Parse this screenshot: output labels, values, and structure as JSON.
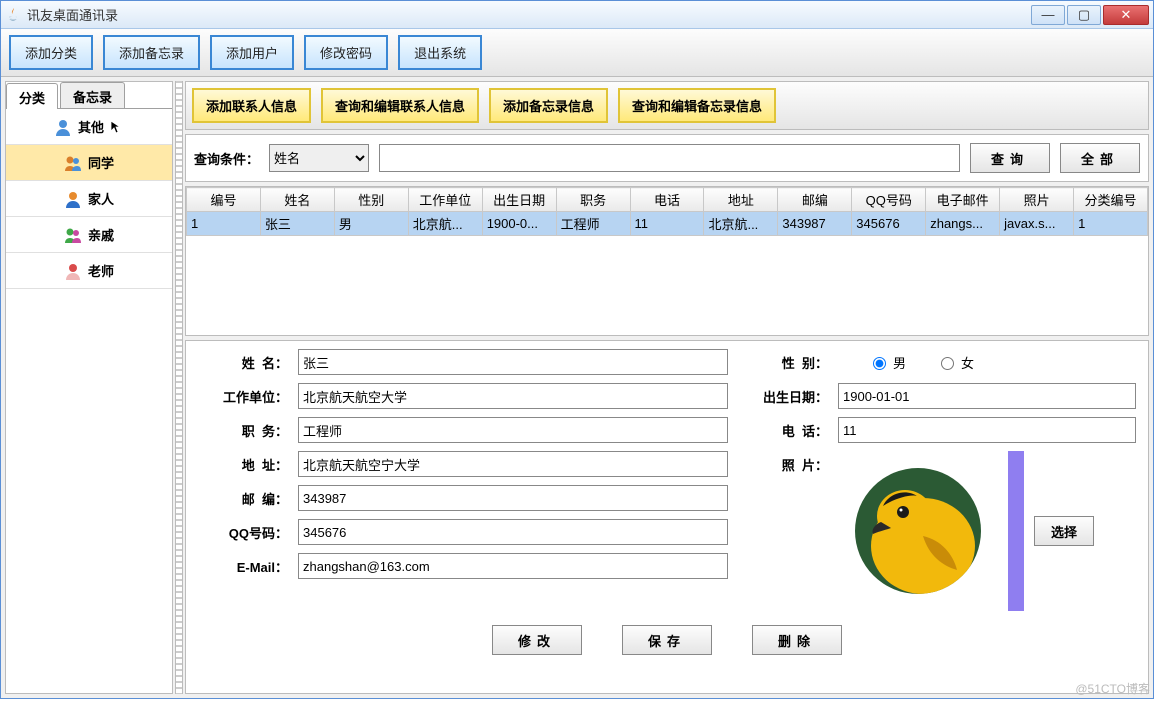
{
  "window": {
    "title": "讯友桌面通讯录"
  },
  "toolbar": {
    "add_category": "添加分类",
    "add_memo": "添加备忘录",
    "add_user": "添加用户",
    "change_password": "修改密码",
    "exit_system": "退出系统"
  },
  "left": {
    "tabs": {
      "category": "分类",
      "memo": "备忘录"
    },
    "categories": {
      "other": "其他",
      "classmate": "同学",
      "family": "家人",
      "relative": "亲戚",
      "teacher": "老师"
    }
  },
  "subtoolbar": {
    "add_contact": "添加联系人信息",
    "query_edit_contact": "查询和编辑联系人信息",
    "add_memo": "添加备忘录信息",
    "query_edit_memo": "查询和编辑备忘录信息"
  },
  "search": {
    "label": "查询条件：",
    "field_option": "姓名",
    "value": "",
    "query_btn": "查询",
    "all_btn": "全部"
  },
  "table": {
    "headers": [
      "编号",
      "姓名",
      "性别",
      "工作单位",
      "出生日期",
      "职务",
      "电话",
      "地址",
      "邮编",
      "QQ号码",
      "电子邮件",
      "照片",
      "分类编号"
    ],
    "row": [
      "1",
      "张三",
      "男",
      "北京航...",
      "1900-0...",
      "工程师",
      "11",
      "北京航...",
      "343987",
      "345676",
      "zhangs...",
      "javax.s...",
      "1"
    ]
  },
  "form": {
    "labels": {
      "name": "姓  名：",
      "gender": "性  别：",
      "male": "男",
      "female": "女",
      "workplace": "工作单位：",
      "birth": "出生日期：",
      "position": "职  务：",
      "phone": "电  话：",
      "address": "地  址：",
      "photo": "照  片：",
      "zip": "邮  编：",
      "qq": "QQ号码：",
      "email": "E-Mail："
    },
    "values": {
      "name": "张三",
      "workplace": "北京航天航空大学",
      "birth": "1900-01-01",
      "position": "工程师",
      "phone": "11",
      "address": "北京航天航空宁大学",
      "zip": "343987",
      "qq": "345676",
      "email": "zhangshan@163.com"
    },
    "select_btn": "选择",
    "modify_btn": "修改",
    "save_btn": "保存",
    "delete_btn": "删除"
  },
  "watermark": "@51CTO博客"
}
